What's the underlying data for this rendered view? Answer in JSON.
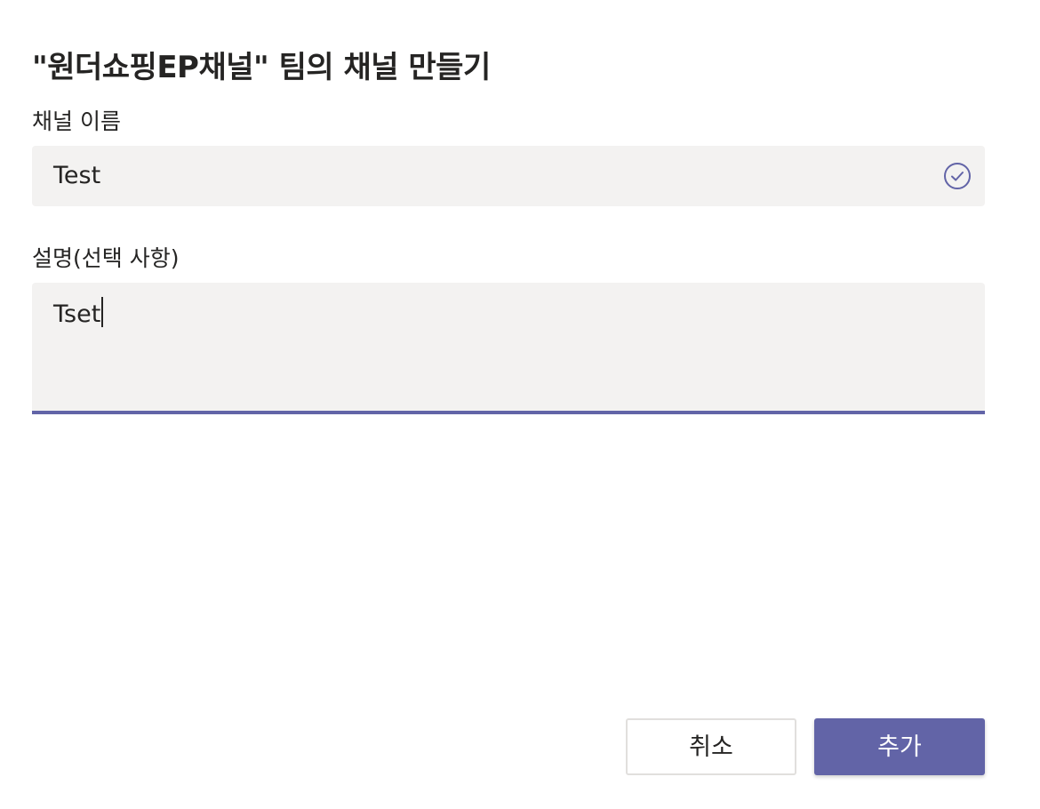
{
  "dialog": {
    "title": "\"원더쇼핑EP채널\" 팀의 채널 만들기"
  },
  "channel_name": {
    "label": "채널 이름",
    "value": "Test",
    "status_icon": "check-circle-icon"
  },
  "description": {
    "label": "설명(선택 사항)",
    "value": "Tset"
  },
  "buttons": {
    "cancel_label": "취소",
    "add_label": "추가"
  },
  "colors": {
    "accent": "#6264a7",
    "field_background": "#f3f2f1",
    "text": "#252423"
  }
}
